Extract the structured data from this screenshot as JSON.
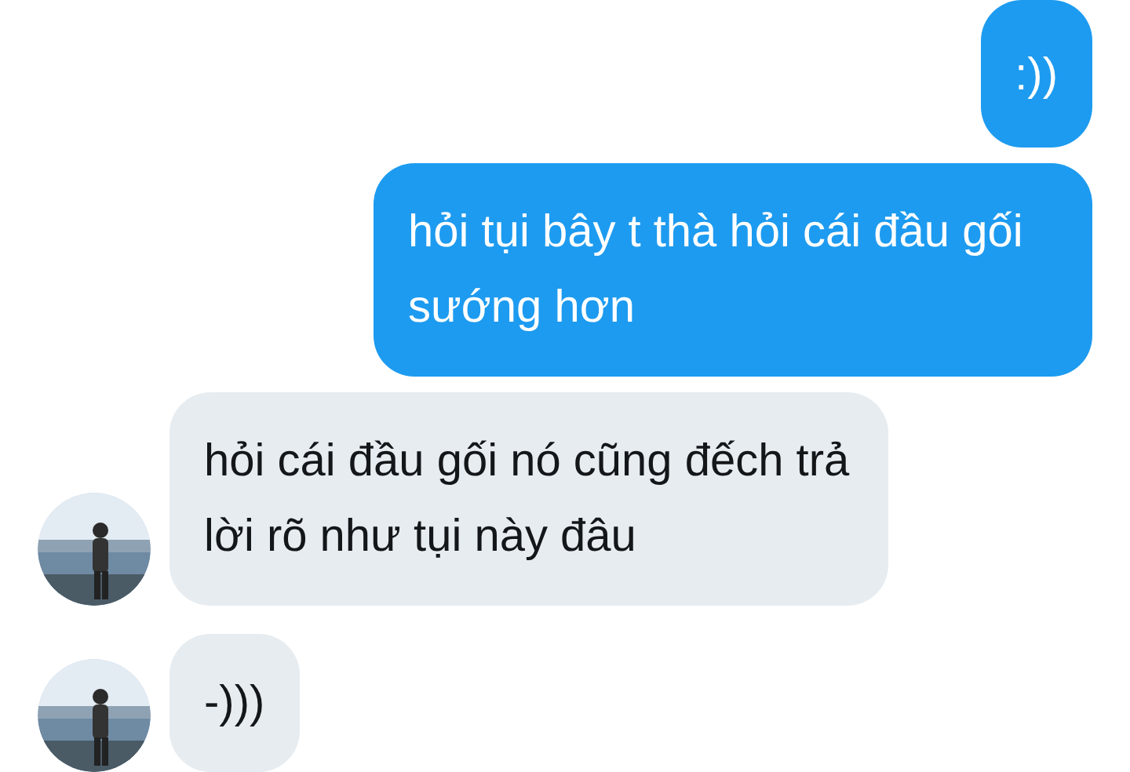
{
  "messages": [
    {
      "kind": "sent",
      "text": ":))"
    },
    {
      "kind": "sent",
      "text": "hỏi tụi bây t thà hỏi cái đầu gối sướng hơn"
    },
    {
      "kind": "received",
      "text": "hỏi cái đầu gối nó cũng đếch trả lời rõ như tụi này đâu"
    },
    {
      "kind": "received",
      "text": "-)))"
    }
  ]
}
